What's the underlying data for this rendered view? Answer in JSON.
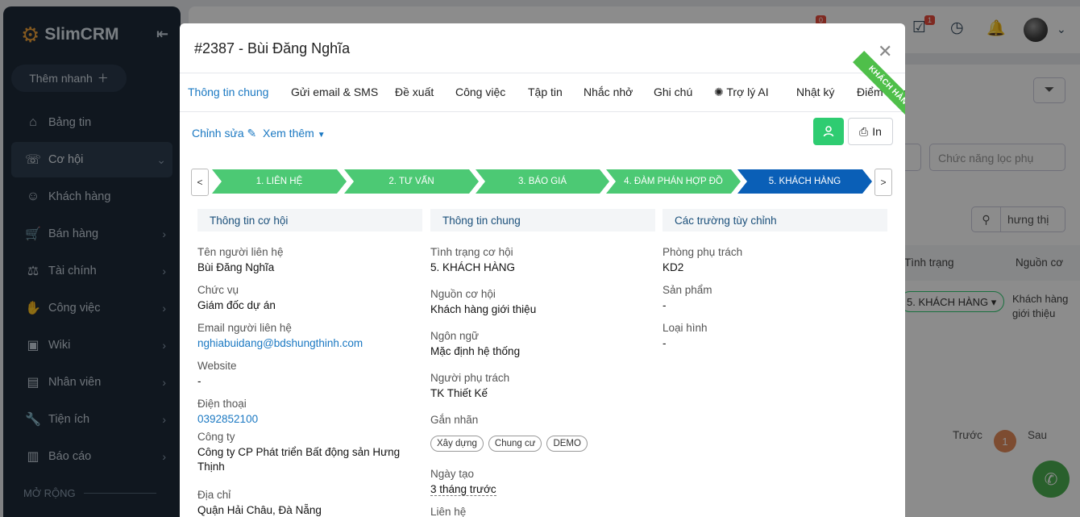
{
  "sidebar": {
    "brand": "SlimCRM",
    "quick_add": "Thêm nhanh",
    "items": [
      {
        "label": "Bảng tin",
        "icon": "home-icon",
        "has_chevron": false
      },
      {
        "label": "Cơ hội",
        "icon": "phone-icon",
        "has_chevron": true,
        "active": true
      },
      {
        "label": "Khách hàng",
        "icon": "user-icon",
        "has_chevron": false
      },
      {
        "label": "Bán hàng",
        "icon": "cart-icon",
        "has_chevron": true
      },
      {
        "label": "Tài chính",
        "icon": "scale-icon",
        "has_chevron": true
      },
      {
        "label": "Công việc",
        "icon": "handshake-icon",
        "has_chevron": true
      },
      {
        "label": "Wiki",
        "icon": "wiki-icon",
        "has_chevron": true
      },
      {
        "label": "Nhân viên",
        "icon": "id-card-icon",
        "has_chevron": true
      },
      {
        "label": "Tiện ích",
        "icon": "wrench-icon",
        "has_chevron": true
      },
      {
        "label": "Báo cáo",
        "icon": "chart-icon",
        "has_chevron": true
      }
    ],
    "section": "MỞ RỘNG"
  },
  "topbar": {
    "badge_1": "0",
    "badge_2": "1"
  },
  "background": {
    "filter_placeholder": "Chức năng lọc phụ",
    "search_value": "hưng thị",
    "col_status": "Tình trạng",
    "col_source": "Nguồn cơ",
    "row_status": "5. KHÁCH HÀNG",
    "row_source": "Khách hàng giới thiệu",
    "pager_prev": "Trước",
    "pager_page": "1",
    "pager_next": "Sau"
  },
  "modal": {
    "title": "#2387 - Bùi Đăng Nghĩa",
    "ribbon": "KHÁCH HÀNG",
    "tabs": [
      "Thông tin chung",
      "Gửi email & SMS",
      "Đề xuất",
      "Công việc",
      "Tập tin",
      "Nhắc nhở",
      "Ghi chú",
      "Trợ lý AI",
      "Nhật ký",
      "Điểm thưởng"
    ],
    "edit_link": "Chỉnh sửa",
    "more_link": "Xem thêm",
    "print_label": "In",
    "stages": [
      "1. LIÊN HỆ",
      "2. TƯ VẤN",
      "3. BÁO GIÁ",
      "4. ĐÀM PHÁN HỢP ĐỒ",
      "5. KHÁCH HÀNG"
    ],
    "col1": {
      "header": "Thông tin cơ hội",
      "fields": [
        {
          "label": "Tên người liên hệ",
          "value": "Bùi Đăng Nghĩa"
        },
        {
          "label": "Chức vụ",
          "value": "Giám đốc dự án"
        },
        {
          "label": "Email người liên hệ",
          "value": "nghiabuidang@bdshungthinh.com"
        },
        {
          "label": "Website",
          "value": "-"
        },
        {
          "label": "Điện thoại",
          "value": "0392852100"
        },
        {
          "label": "Công ty",
          "value": "Công ty CP Phát triển Bất động sản Hưng Thịnh"
        },
        {
          "label": "Địa chỉ",
          "value": "Quận Hải Châu, Đà Nẵng"
        }
      ]
    },
    "col2": {
      "header": "Thông tin chung",
      "fields": [
        {
          "label": "Tình trạng cơ hội",
          "value": "5. KHÁCH HÀNG"
        },
        {
          "label": "Nguồn cơ hội",
          "value": "Khách hàng giới thiệu"
        },
        {
          "label": "Ngôn ngữ",
          "value": "Mặc định hệ thống"
        },
        {
          "label": "Người phụ trách",
          "value": "TK Thiết Kế"
        },
        {
          "label": "Gắn nhãn",
          "value": ""
        },
        {
          "label": "Ngày tạo",
          "value": "3 tháng trước"
        },
        {
          "label": "Liên hệ",
          "value": ""
        }
      ],
      "tags": [
        "Xây dựng",
        "Chung cư",
        "DEMO"
      ]
    },
    "col3": {
      "header": "Các trường tùy chỉnh",
      "fields": [
        {
          "label": "Phòng phụ trách",
          "value": "KD2"
        },
        {
          "label": "Sản phẩm",
          "value": "-"
        },
        {
          "label": "Loại hình",
          "value": "-"
        }
      ]
    }
  }
}
